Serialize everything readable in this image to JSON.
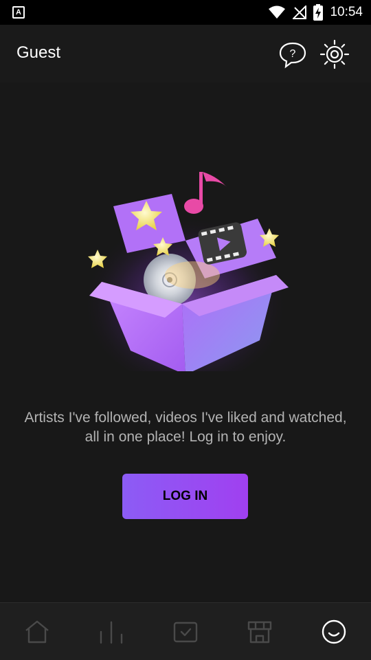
{
  "status_bar": {
    "time": "10:54",
    "left_icon": "a-letter-icon",
    "left_icon_text": "A",
    "icons": [
      "wifi-icon",
      "no-signal-icon",
      "battery-charging-icon"
    ]
  },
  "header": {
    "title": "Guest",
    "help_icon": "help-bubble-icon",
    "settings_icon": "settings-sun-icon"
  },
  "main": {
    "illustration": "gift-box-media-illustration",
    "message": "Artists I've followed, videos I've liked and watched, all in one place! Log in to enjoy.",
    "login_label": "LOG IN"
  },
  "tabs": [
    {
      "icon": "home-icon",
      "active": false
    },
    {
      "icon": "chart-bars-icon",
      "active": false
    },
    {
      "icon": "checkbox-icon",
      "active": false
    },
    {
      "icon": "store-icon",
      "active": false
    },
    {
      "icon": "smile-profile-icon",
      "active": true
    }
  ],
  "colors": {
    "accent_start": "#8c5cf5",
    "accent_end": "#a040f0",
    "background": "#181818",
    "text_secondary": "#b3b3b3",
    "tab_inactive": "#4a4a4a",
    "tab_active": "#ffffff"
  }
}
